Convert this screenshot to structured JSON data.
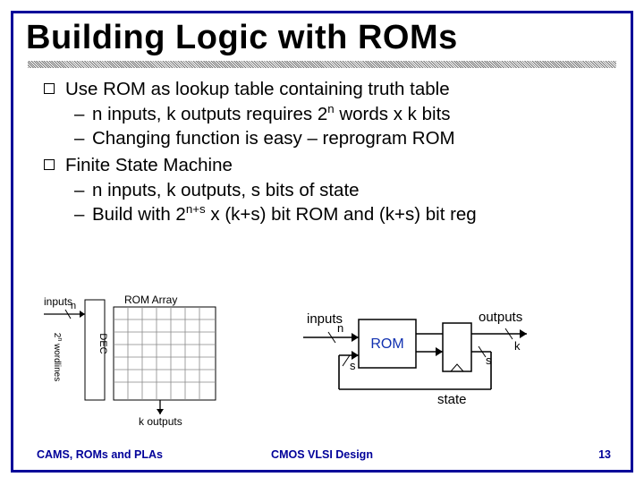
{
  "title": "Building Logic with ROMs",
  "bullets": {
    "b1": "Use ROM as lookup table containing truth table",
    "b1s1_a": "n inputs, k outputs requires 2",
    "b1s1_sup": "n",
    "b1s1_b": " words x k bits",
    "b1s2": "Changing function is easy – reprogram ROM",
    "b2": "Finite State Machine",
    "b2s1": "n inputs, k outputs, s bits of state",
    "b2s2_a": "Build with 2",
    "b2s2_sup": "n+s",
    "b2s2_b": " x (k+s) bit ROM and (k+s) bit reg"
  },
  "fig1": {
    "inputs": "inputs",
    "rom_array": "ROM Array",
    "dec": "DEC",
    "wordlines_a": "2",
    "wordlines_sup": "n",
    "wordlines_b": " wordlines",
    "k_outputs": "k outputs",
    "n": "n"
  },
  "fig2": {
    "inputs": "inputs",
    "outputs": "outputs",
    "rom": "ROM",
    "state": "state",
    "n": "n",
    "k": "k",
    "s1": "s",
    "s2": "s"
  },
  "footer": {
    "left": "CAMS, ROMs and PLAs",
    "center": "CMOS VLSI Design",
    "right": "13"
  }
}
